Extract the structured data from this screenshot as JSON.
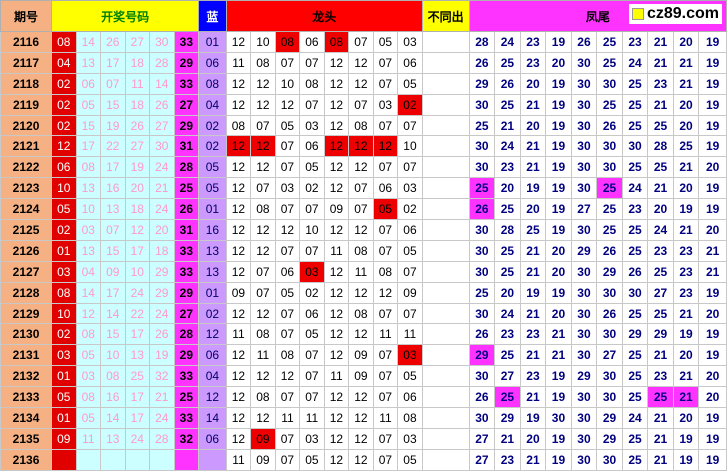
{
  "headers": {
    "period": "期号",
    "draw": "开奖号码",
    "blue": "蓝",
    "dragon": "龙头",
    "diff": "不同出",
    "phoenix": "凤尾",
    "logo": "cz89.com"
  },
  "colors": {
    "period_bg": "#f5b183",
    "draw_header_bg": "#ffff00",
    "red_ball": "#e00000",
    "pale_ball_bg": "#ccffff",
    "pale_ball_text": "#ff99cc",
    "sum_bg": "#ff33ff",
    "blue_col_bg": "#cc99ff",
    "highlight": "#ee0000",
    "tail_highlight": "#ff33ff"
  },
  "rows": [
    {
      "period": "2116",
      "red": "08",
      "pale": [
        "14",
        "26",
        "27",
        "30"
      ],
      "sum": "33",
      "blue": "01",
      "dragon": [
        "12",
        "10",
        "08",
        "06",
        "08",
        "07",
        "05",
        "03"
      ],
      "dhit": [
        2,
        4
      ],
      "gaphit": false,
      "tail": [
        "28",
        "24",
        "23",
        "19",
        "26",
        "25",
        "23",
        "21",
        "20",
        "19"
      ],
      "thit": []
    },
    {
      "period": "2117",
      "red": "04",
      "pale": [
        "13",
        "17",
        "18",
        "28"
      ],
      "sum": "29",
      "blue": "06",
      "dragon": [
        "11",
        "08",
        "07",
        "07",
        "12",
        "12",
        "07",
        "06"
      ],
      "dhit": [],
      "gaphit": false,
      "tail": [
        "26",
        "25",
        "23",
        "20",
        "30",
        "25",
        "24",
        "21",
        "21",
        "19"
      ],
      "thit": []
    },
    {
      "period": "2118",
      "red": "02",
      "pale": [
        "06",
        "07",
        "11",
        "14"
      ],
      "sum": "33",
      "blue": "08",
      "dragon": [
        "12",
        "12",
        "10",
        "08",
        "12",
        "12",
        "07",
        "05"
      ],
      "dhit": [],
      "gaphit": false,
      "tail": [
        "29",
        "26",
        "20",
        "19",
        "30",
        "30",
        "25",
        "23",
        "21",
        "19"
      ],
      "thit": []
    },
    {
      "period": "2119",
      "red": "02",
      "pale": [
        "05",
        "15",
        "18",
        "26"
      ],
      "sum": "27",
      "blue": "04",
      "dragon": [
        "12",
        "12",
        "12",
        "07",
        "12",
        "07",
        "03",
        "02"
      ],
      "dhit": [
        7
      ],
      "gaphit": false,
      "tail": [
        "30",
        "25",
        "21",
        "19",
        "30",
        "25",
        "25",
        "21",
        "20",
        "19"
      ],
      "thit": []
    },
    {
      "period": "2120",
      "red": "02",
      "pale": [
        "15",
        "19",
        "26",
        "27"
      ],
      "sum": "29",
      "blue": "02",
      "dragon": [
        "08",
        "07",
        "05",
        "03",
        "12",
        "08",
        "07",
        "07"
      ],
      "dhit": [],
      "gaphit": false,
      "tail": [
        "25",
        "21",
        "20",
        "19",
        "30",
        "26",
        "25",
        "25",
        "20",
        "19"
      ],
      "thit": []
    },
    {
      "period": "2121",
      "red": "12",
      "pale": [
        "17",
        "22",
        "27",
        "30"
      ],
      "sum": "31",
      "blue": "02",
      "dragon": [
        "12",
        "12",
        "07",
        "06",
        "12",
        "12",
        "12",
        "10"
      ],
      "dhit": [
        0,
        1,
        4,
        5,
        6
      ],
      "gaphit": false,
      "tail": [
        "30",
        "24",
        "21",
        "19",
        "30",
        "30",
        "30",
        "28",
        "25",
        "19"
      ],
      "thit": []
    },
    {
      "period": "2122",
      "red": "06",
      "pale": [
        "08",
        "17",
        "19",
        "24"
      ],
      "sum": "28",
      "blue": "05",
      "dragon": [
        "12",
        "12",
        "07",
        "05",
        "12",
        "12",
        "07",
        "07"
      ],
      "dhit": [],
      "gaphit": false,
      "tail": [
        "30",
        "23",
        "21",
        "19",
        "30",
        "30",
        "25",
        "25",
        "21",
        "20"
      ],
      "thit": []
    },
    {
      "period": "2123",
      "red": "10",
      "pale": [
        "13",
        "16",
        "20",
        "21"
      ],
      "sum": "25",
      "blue": "05",
      "dragon": [
        "12",
        "07",
        "03",
        "02",
        "12",
        "07",
        "06",
        "03"
      ],
      "dhit": [],
      "gaphit": false,
      "tail": [
        "25",
        "20",
        "19",
        "19",
        "30",
        "25",
        "24",
        "21",
        "20",
        "19"
      ],
      "thit": [
        0,
        5
      ]
    },
    {
      "period": "2124",
      "red": "05",
      "pale": [
        "10",
        "13",
        "18",
        "24"
      ],
      "sum": "26",
      "blue": "01",
      "dragon": [
        "12",
        "08",
        "07",
        "07",
        "09",
        "07",
        "05",
        "02"
      ],
      "dhit": [
        6
      ],
      "gaphit": false,
      "tail": [
        "26",
        "25",
        "20",
        "19",
        "27",
        "25",
        "23",
        "20",
        "19",
        "19"
      ],
      "thit": [
        0
      ]
    },
    {
      "period": "2125",
      "red": "02",
      "pale": [
        "03",
        "07",
        "12",
        "20"
      ],
      "sum": "31",
      "blue": "16",
      "dragon": [
        "12",
        "12",
        "12",
        "10",
        "12",
        "12",
        "07",
        "06"
      ],
      "dhit": [],
      "gaphit": false,
      "tail": [
        "30",
        "28",
        "25",
        "19",
        "30",
        "25",
        "25",
        "24",
        "21",
        "20"
      ],
      "thit": []
    },
    {
      "period": "2126",
      "red": "01",
      "pale": [
        "13",
        "15",
        "17",
        "18"
      ],
      "sum": "33",
      "blue": "13",
      "dragon": [
        "12",
        "12",
        "07",
        "07",
        "11",
        "08",
        "07",
        "05"
      ],
      "dhit": [],
      "gaphit": false,
      "tail": [
        "30",
        "25",
        "21",
        "20",
        "29",
        "26",
        "25",
        "23",
        "23",
        "21"
      ],
      "thit": []
    },
    {
      "period": "2127",
      "red": "03",
      "pale": [
        "04",
        "09",
        "10",
        "29"
      ],
      "sum": "33",
      "blue": "13",
      "dragon": [
        "12",
        "07",
        "06",
        "03",
        "12",
        "11",
        "08",
        "07"
      ],
      "dhit": [
        3
      ],
      "gaphit": false,
      "tail": [
        "30",
        "25",
        "21",
        "20",
        "30",
        "29",
        "26",
        "25",
        "23",
        "21"
      ],
      "thit": []
    },
    {
      "period": "2128",
      "red": "08",
      "pale": [
        "14",
        "17",
        "24",
        "29"
      ],
      "sum": "29",
      "blue": "01",
      "dragon": [
        "09",
        "07",
        "05",
        "02",
        "12",
        "12",
        "12",
        "09"
      ],
      "dhit": [],
      "gaphit": false,
      "tail": [
        "25",
        "20",
        "19",
        "19",
        "30",
        "30",
        "30",
        "27",
        "23",
        "19"
      ],
      "thit": []
    },
    {
      "period": "2129",
      "red": "10",
      "pale": [
        "12",
        "14",
        "22",
        "24"
      ],
      "sum": "27",
      "blue": "02",
      "dragon": [
        "12",
        "12",
        "07",
        "06",
        "12",
        "08",
        "07",
        "07"
      ],
      "dhit": [],
      "gaphit": false,
      "tail": [
        "30",
        "24",
        "21",
        "20",
        "30",
        "26",
        "25",
        "25",
        "21",
        "20"
      ],
      "thit": []
    },
    {
      "period": "2130",
      "red": "02",
      "pale": [
        "08",
        "15",
        "17",
        "26"
      ],
      "sum": "28",
      "blue": "12",
      "dragon": [
        "11",
        "08",
        "07",
        "05",
        "12",
        "12",
        "11",
        "11"
      ],
      "dhit": [],
      "gaphit": false,
      "tail": [
        "26",
        "23",
        "23",
        "21",
        "30",
        "30",
        "29",
        "29",
        "19",
        "19"
      ],
      "thit": []
    },
    {
      "period": "2131",
      "red": "03",
      "pale": [
        "05",
        "10",
        "13",
        "19"
      ],
      "sum": "29",
      "blue": "06",
      "dragon": [
        "12",
        "11",
        "08",
        "07",
        "12",
        "09",
        "07",
        "03"
      ],
      "dhit": [
        7
      ],
      "gaphit": false,
      "tail": [
        "29",
        "25",
        "21",
        "21",
        "30",
        "27",
        "25",
        "21",
        "20",
        "19"
      ],
      "thit": [
        0
      ]
    },
    {
      "period": "2132",
      "red": "01",
      "pale": [
        "03",
        "08",
        "25",
        "32"
      ],
      "sum": "33",
      "blue": "04",
      "dragon": [
        "12",
        "12",
        "12",
        "07",
        "11",
        "09",
        "07",
        "05"
      ],
      "dhit": [],
      "gaphit": false,
      "tail": [
        "30",
        "27",
        "23",
        "19",
        "29",
        "30",
        "25",
        "23",
        "21",
        "20"
      ],
      "thit": []
    },
    {
      "period": "2133",
      "red": "05",
      "pale": [
        "08",
        "16",
        "17",
        "21"
      ],
      "sum": "25",
      "blue": "12",
      "dragon": [
        "12",
        "08",
        "07",
        "07",
        "12",
        "12",
        "07",
        "06"
      ],
      "dhit": [],
      "gaphit": false,
      "tail": [
        "26",
        "25",
        "21",
        "19",
        "30",
        "30",
        "25",
        "25",
        "21",
        "20"
      ],
      "thit": [
        1,
        7,
        8
      ]
    },
    {
      "period": "2134",
      "red": "01",
      "pale": [
        "05",
        "14",
        "17",
        "24"
      ],
      "sum": "33",
      "blue": "14",
      "dragon": [
        "12",
        "12",
        "11",
        "11",
        "12",
        "12",
        "11",
        "08"
      ],
      "dhit": [],
      "gaphit": false,
      "tail": [
        "30",
        "29",
        "19",
        "30",
        "30",
        "29",
        "24",
        "21",
        "20",
        "19"
      ],
      "thit": []
    },
    {
      "period": "2135",
      "red": "09",
      "pale": [
        "11",
        "13",
        "24",
        "28"
      ],
      "sum": "32",
      "blue": "06",
      "dragon": [
        "12",
        "09",
        "07",
        "03",
        "12",
        "12",
        "07",
        "03"
      ],
      "dhit": [
        1
      ],
      "gaphit": false,
      "tail": [
        "27",
        "21",
        "20",
        "19",
        "30",
        "29",
        "25",
        "21",
        "19",
        "19"
      ],
      "thit": []
    },
    {
      "period": "2136",
      "red": "",
      "pale": [
        "",
        "",
        "",
        ""
      ],
      "sum": "",
      "blue": "",
      "dragon": [
        "11",
        "09",
        "07",
        "05",
        "12",
        "12",
        "07",
        "05"
      ],
      "dhit": [],
      "gaphit": false,
      "tail": [
        "27",
        "23",
        "21",
        "19",
        "30",
        "30",
        "25",
        "21",
        "19",
        "19"
      ],
      "thit": []
    }
  ]
}
